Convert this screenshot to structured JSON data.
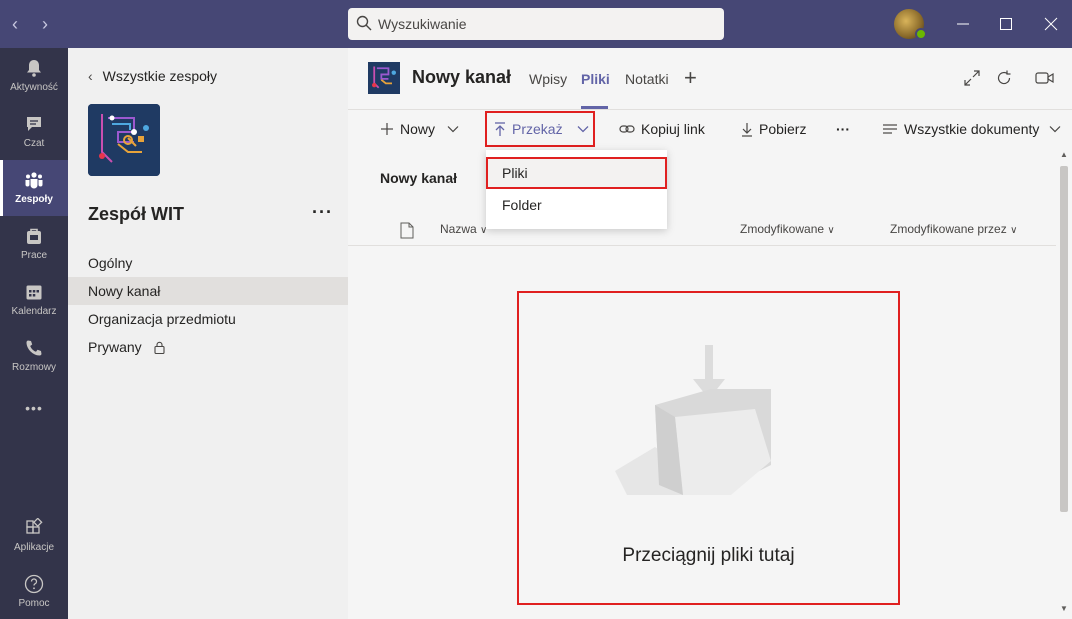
{
  "titlebar": {
    "search_placeholder": "Wyszukiwanie",
    "accent": "#464775"
  },
  "rail": {
    "items": [
      {
        "label": "Aktywność",
        "icon": "bell-icon"
      },
      {
        "label": "Czat",
        "icon": "chat-icon"
      },
      {
        "label": "Zespoły",
        "icon": "teams-icon",
        "active": true
      },
      {
        "label": "Prace",
        "icon": "assignments-icon"
      },
      {
        "label": "Kalendarz",
        "icon": "calendar-icon"
      },
      {
        "label": "Rozmowy",
        "icon": "phone-icon"
      },
      {
        "label": "Aplikacje",
        "icon": "apps-icon"
      },
      {
        "label": "Pomoc",
        "icon": "help-icon"
      }
    ],
    "more": "•••"
  },
  "teams_panel": {
    "back_label": "Wszystkie zespoły",
    "team_name": "Zespół WIT",
    "more": "···",
    "channels": [
      {
        "label": "Ogólny"
      },
      {
        "label": "Nowy kanał",
        "active": true
      },
      {
        "label": "Organizacja przedmiotu"
      },
      {
        "label": "Prywany",
        "locked": true
      }
    ]
  },
  "header": {
    "channel_title": "Nowy kanał",
    "tabs": [
      {
        "label": "Wpisy"
      },
      {
        "label": "Pliki",
        "active": true
      },
      {
        "label": "Notatki"
      }
    ],
    "add_tab": "+"
  },
  "toolbar": {
    "new_label": "Nowy",
    "upload_label": "Przekaż",
    "copy_link_label": "Kopiuj link",
    "download_label": "Pobierz",
    "more": "···",
    "view_label": "Wszystkie dokumenty"
  },
  "upload_menu": {
    "items": [
      {
        "label": "Pliki"
      },
      {
        "label": "Folder"
      }
    ]
  },
  "files": {
    "breadcrumb": "Nowy kanał",
    "columns": {
      "name": "Nazwa",
      "modified": "Zmodyfikowane",
      "modified_by": "Zmodyfikowane przez"
    },
    "empty_text": "Przeciągnij pliki tutaj"
  }
}
